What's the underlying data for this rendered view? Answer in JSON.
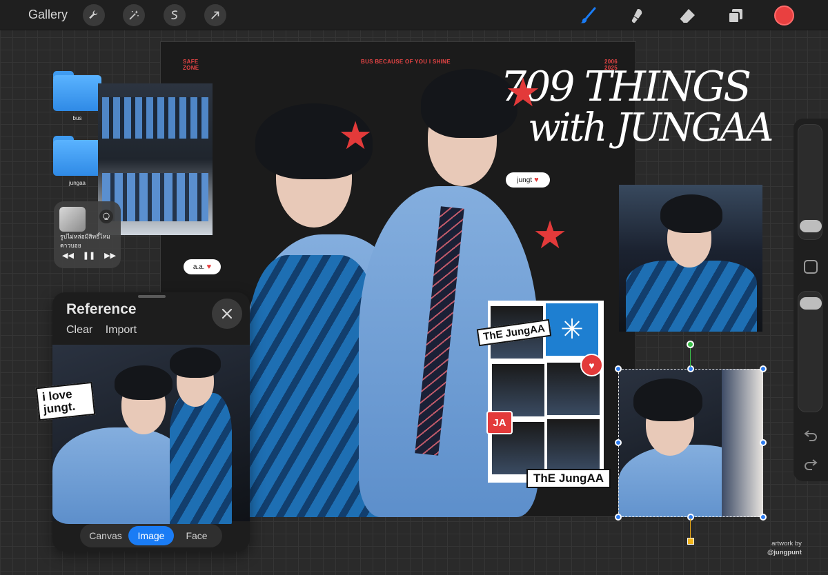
{
  "toolbar": {
    "gallery_label": "Gallery",
    "left_tools": [
      "wrench-icon",
      "magic-wand-icon",
      "selection-icon",
      "move-arrow-icon"
    ],
    "right_tools": [
      "brush-icon",
      "smudge-icon",
      "eraser-icon",
      "layers-icon"
    ],
    "active_color": "#e94040",
    "active_tool_color": "#1a7cf5"
  },
  "desktop": {
    "folders": [
      {
        "label": "bus"
      },
      {
        "label": "jungaa"
      }
    ],
    "music": {
      "title": "รูปไม่หล่อมีสิทธิ์ไหม คาวบอย"
    }
  },
  "board": {
    "header_left": "SAFE ZONE",
    "header_center": "BUS  BECAUSE OF YOU I SHINE",
    "header_right": "2006 2025",
    "headline_line1": "709 THINGS",
    "headline_line2": "with JUNGAA",
    "bubble_jungt": "jungt",
    "bubble_aa": "a.a.",
    "sticker_love": "i love jungt.",
    "sticker_ja": "JA",
    "sticker_the_jungaa": "ThE JungAA"
  },
  "reference": {
    "title": "Reference",
    "clear_label": "Clear",
    "import_label": "Import",
    "tabs": [
      {
        "label": "Canvas",
        "active": false
      },
      {
        "label": "Image",
        "active": true
      },
      {
        "label": "Face",
        "active": false
      }
    ]
  },
  "credit": {
    "line1": "artwork by",
    "line2": "@jungpunt"
  }
}
